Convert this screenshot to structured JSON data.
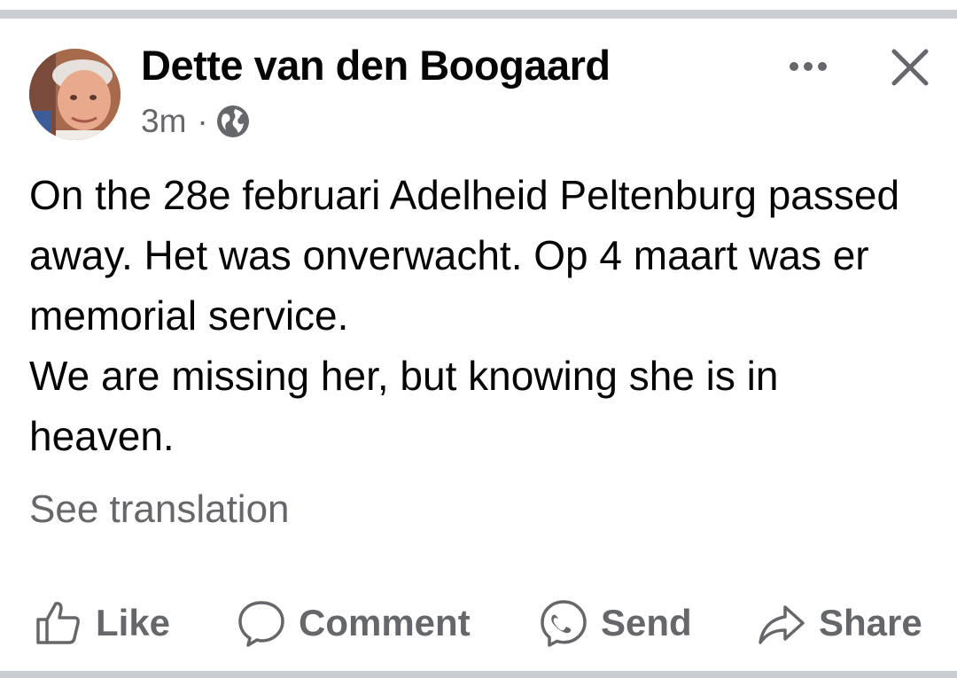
{
  "post": {
    "author": "Dette van den Boogaard",
    "timestamp": "3m",
    "separator": "·",
    "audience_icon": "globe-icon",
    "text": "On the 28e februari Adelheid Peltenburg passed away. Het was onverwacht. Op 4 maart was er memorial service.\nWe are missing her, but knowing she is in heaven.",
    "see_translation": "See translation"
  },
  "header_actions": {
    "more_icon": "more-horizontal-icon",
    "close_icon": "close-icon"
  },
  "actions": [
    {
      "label": "Like",
      "icon": "thumbs-up-icon"
    },
    {
      "label": "Comment",
      "icon": "comment-icon"
    },
    {
      "label": "Send",
      "icon": "messenger-icon"
    },
    {
      "label": "Share",
      "icon": "share-icon"
    }
  ],
  "colors": {
    "primary_text": "#050505",
    "secondary_text": "#65676b",
    "divider": "#c9ccd1"
  }
}
